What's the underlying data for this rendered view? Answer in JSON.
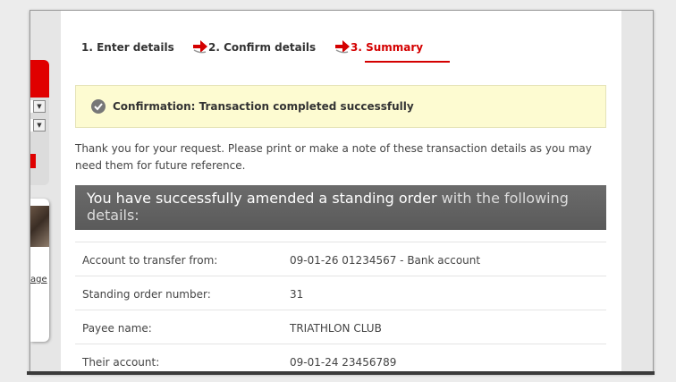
{
  "sidebar": {
    "partial_link_text": "age"
  },
  "steps": [
    {
      "label": "1. Enter details",
      "active": false
    },
    {
      "label": "2. Confirm details",
      "active": false
    },
    {
      "label": "3. Summary",
      "active": true
    }
  ],
  "confirmation": {
    "text": "Confirmation: Transaction completed successfully"
  },
  "intro_text": "Thank you for your request. Please print or make a note of these transaction details as you may need them for future reference.",
  "banner": {
    "highlight": "You have successfully amended a standing order",
    "rest": " with the following details:"
  },
  "details": [
    {
      "label": "Account to transfer from:",
      "value": "09-01-26 01234567 - Bank account"
    },
    {
      "label": "Standing order number:",
      "value": "31"
    },
    {
      "label": "Payee name:",
      "value": "TRIATHLON CLUB"
    },
    {
      "label": "Their account:",
      "value": "09-01-24 23456789"
    }
  ],
  "colors": {
    "accent_red": "#d40000",
    "confirm_bg": "#fdfbd1",
    "banner_bg": "#666666"
  }
}
